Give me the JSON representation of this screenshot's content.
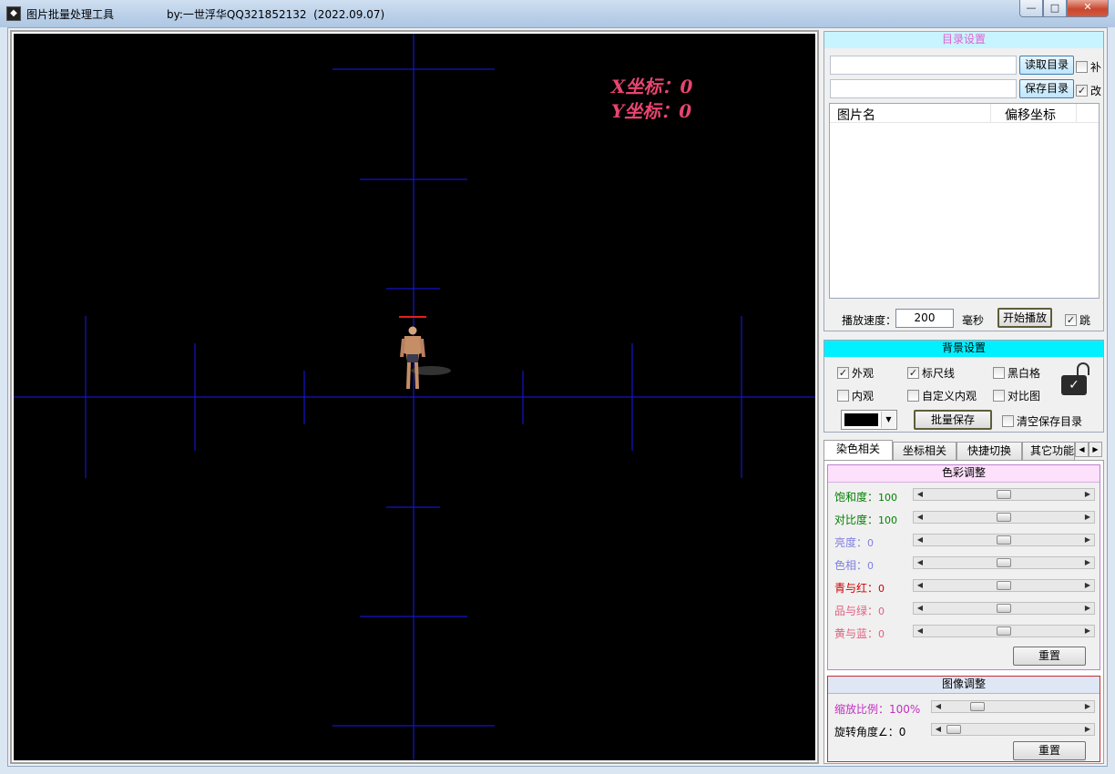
{
  "window": {
    "title": "图片批量处理工具",
    "author": "by:一世浮华QQ321852132  (2022.09.07)",
    "min_icon": "minimize-icon",
    "max_icon": "maximize-icon",
    "close_icon": "close-icon"
  },
  "canvas": {
    "x_label": "X坐标：0",
    "y_label": "Y坐标：0"
  },
  "directory": {
    "header": "目录设置",
    "read_dir_label": "读取目录",
    "save_dir_label": "保存目录",
    "read_dir_value": "",
    "save_dir_value": "",
    "check_bu": "补",
    "check_gai": "改",
    "col_image_name": "图片名",
    "col_offset": "偏移坐标",
    "speed_label": "播放速度：",
    "speed_value": "200",
    "speed_unit": "毫秒",
    "play_label": "开始播放",
    "check_tiao": "跳"
  },
  "background": {
    "header": "背景设置",
    "appearance": "外观",
    "ruler": "标尺线",
    "bw_grid": "黑白格",
    "inner": "内观",
    "custom_inner": "自定义内观",
    "compare": "对比图",
    "batch_save": "批量保存",
    "clear_dir": "清空保存目录",
    "color_value": "#000000"
  },
  "tabs": [
    "染色相关",
    "坐标相关",
    "快捷切换",
    "其它功能"
  ],
  "color_adjust": {
    "header": "色彩调整",
    "rows": [
      {
        "label": "饱和度：",
        "value": "100",
        "color": "#008000",
        "level": 0.5
      },
      {
        "label": "对比度：",
        "value": "100",
        "color": "#008000",
        "level": 0.5
      },
      {
        "label": "亮度：",
        "value": "0",
        "color": "#8080e0",
        "level": 0.5
      },
      {
        "label": "色相：",
        "value": "0",
        "color": "#8080e0",
        "level": 0.5
      },
      {
        "label": "青与红：",
        "value": "0",
        "color": "#d00000",
        "level": 0.5
      },
      {
        "label": "品与绿：",
        "value": "0",
        "color": "#e06080",
        "level": 0.5
      },
      {
        "label": "黄与蓝：",
        "value": "0",
        "color": "#e06080",
        "level": 0.5
      }
    ],
    "reset": "重置"
  },
  "image_adjust": {
    "header": "图像调整",
    "scale_label": "缩放比例：",
    "scale_value": "100%",
    "rotate_label": "旋转角度∠：",
    "rotate_value": "0",
    "reset": "重置"
  }
}
